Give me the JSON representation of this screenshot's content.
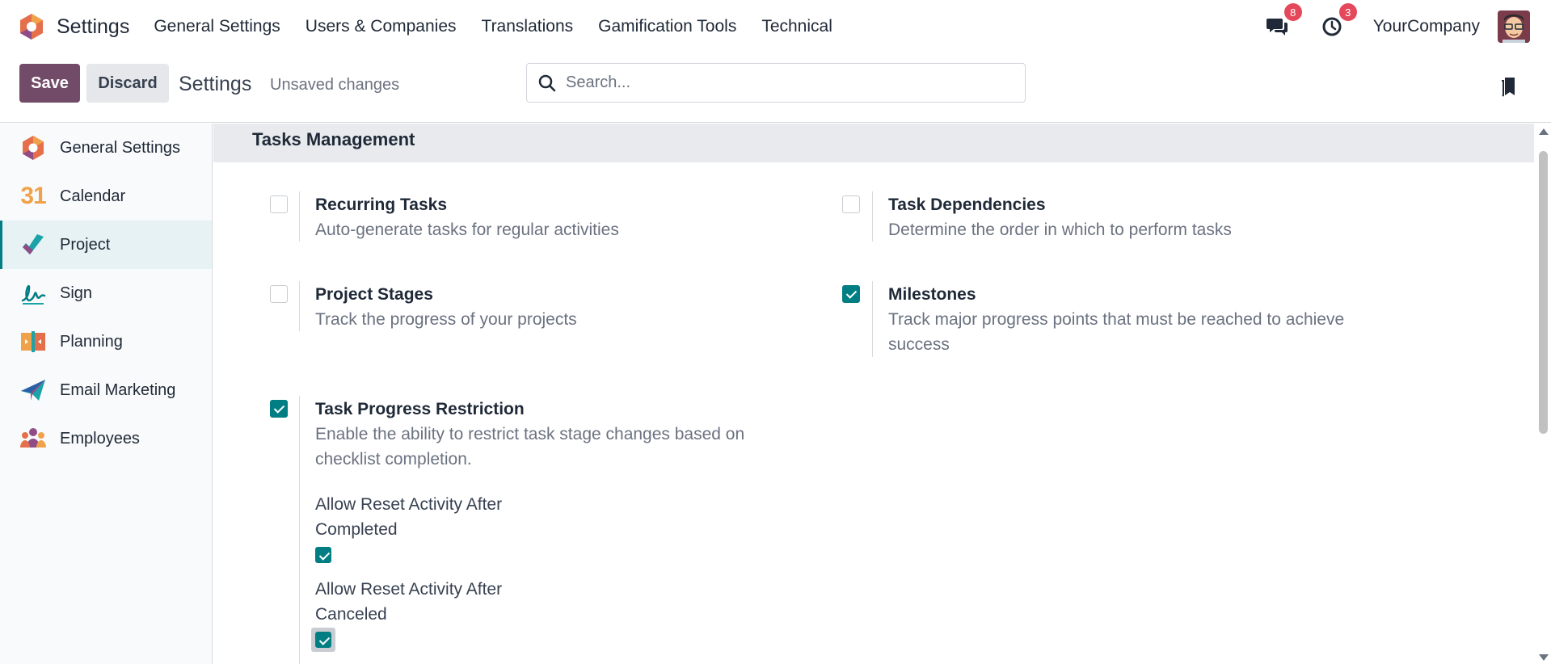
{
  "topnav": {
    "app_name": "Settings",
    "menu": [
      "General Settings",
      "Users & Companies",
      "Translations",
      "Gamification Tools",
      "Technical"
    ],
    "messages_badge": "8",
    "activities_badge": "3",
    "company": "YourCompany"
  },
  "control_panel": {
    "save_label": "Save",
    "discard_label": "Discard",
    "title": "Settings",
    "status": "Unsaved changes",
    "search_placeholder": "Search..."
  },
  "sidebar": {
    "items": [
      {
        "label": "General Settings",
        "icon": "odoo-logo-icon",
        "active": false
      },
      {
        "label": "Calendar",
        "icon": "calendar-icon",
        "active": false
      },
      {
        "label": "Project",
        "icon": "project-icon",
        "active": true
      },
      {
        "label": "Sign",
        "icon": "sign-icon",
        "active": false
      },
      {
        "label": "Planning",
        "icon": "planning-icon",
        "active": false
      },
      {
        "label": "Email Marketing",
        "icon": "email-marketing-icon",
        "active": false
      },
      {
        "label": "Employees",
        "icon": "employees-icon",
        "active": false
      }
    ],
    "calendar_icon_text": "31"
  },
  "main": {
    "section_title": "Tasks Management",
    "settings": {
      "recurring": {
        "title": "Recurring Tasks",
        "desc": "Auto-generate tasks for regular activities",
        "checked": false
      },
      "dependencies": {
        "title": "Task Dependencies",
        "desc": "Determine the order in which to perform tasks",
        "checked": false
      },
      "stages": {
        "title": "Project Stages",
        "desc": "Track the progress of your projects",
        "checked": false
      },
      "milestones": {
        "title": "Milestones",
        "desc": "Track major progress points that must be reached to achieve success",
        "checked": true
      },
      "restriction": {
        "title": "Task Progress Restriction",
        "desc": "Enable the ability to restrict task stage changes based on checklist completion.",
        "checked": true,
        "sub_completed": "Allow Reset Activity After Completed",
        "sub_completed_checked": true,
        "sub_canceled": "Allow Reset Activity After Canceled",
        "sub_canceled_checked": true
      }
    }
  },
  "colors": {
    "brand": "#714b67",
    "accent": "#017e84",
    "badge": "#e4495b"
  }
}
